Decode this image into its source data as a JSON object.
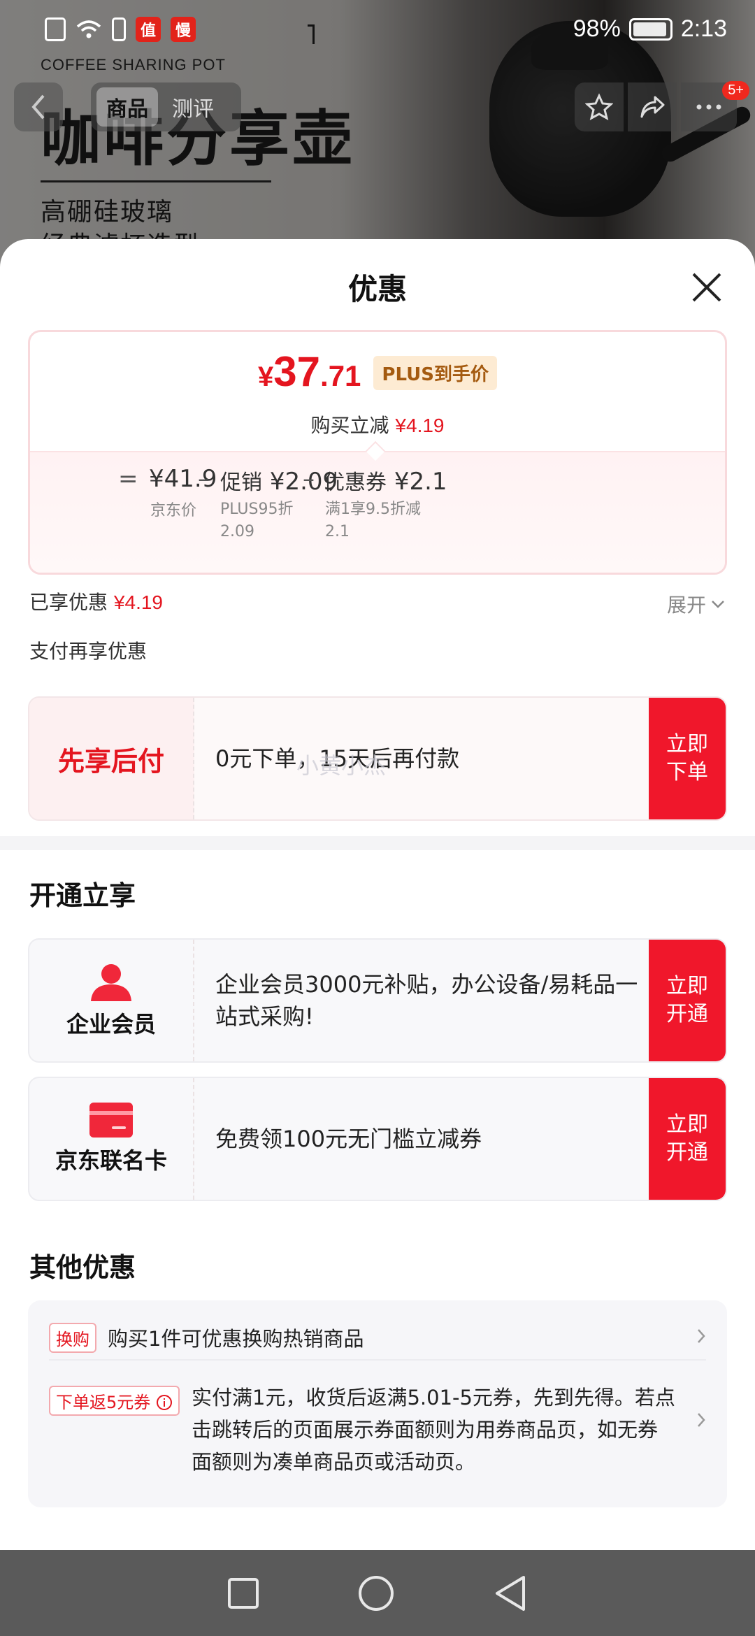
{
  "background": {
    "subtitle_en": "COFFEE SHARING POT",
    "title_cn": "咖啡分享壶",
    "line1": "高硼硅玻璃",
    "line2": "经典滤杯造型"
  },
  "status_bar": {
    "battery": "98%",
    "time": "2:13",
    "app_icon_1": "值",
    "app_icon_2": "慢"
  },
  "product_nav": {
    "tabs": [
      "商品",
      "测评"
    ],
    "badge": "5+"
  },
  "sheet": {
    "title": "优惠",
    "price_card": {
      "yen": "¥",
      "price_int": "37",
      "price_dec": ".71",
      "plus_badge": "PLUS到手价",
      "reduce_label": "购买立减",
      "reduce_value": "¥4.19",
      "eq": "=",
      "jd_price": "¥41.9",
      "jd_price_label": "京东价",
      "minus1": "–",
      "promo_label": "促销",
      "promo_value": "¥2.09",
      "promo_sub1": "PLUS95折",
      "promo_sub2": "2.09",
      "minus2": "–",
      "coupon_label": "优惠券",
      "coupon_value": "¥2.1",
      "coupon_sub1": "满1享9.5折减",
      "coupon_sub2": "2.1"
    },
    "enjoyed_label": "已享优惠",
    "enjoyed_value": "¥4.19",
    "expand_label": "展开",
    "pay_again_label": "支付再享优惠",
    "pay_later": {
      "title": "先享后付",
      "text": "0元下单，15天后再付款",
      "btn_line1": "立即",
      "btn_line2": "下单"
    },
    "watermark": "小黄小杰",
    "open_section_title": "开通立享",
    "enterprise": {
      "title": "企业会员",
      "text": " 企业会员3000元补贴，办公设备/易耗品一站式采购!",
      "btn_line1": "立即",
      "btn_line2": "开通"
    },
    "jd_card": {
      "title": "京东联名卡",
      "text": "免费领100元无门槛立减券",
      "btn_line1": "立即",
      "btn_line2": "开通"
    },
    "other_section_title": "其他优惠",
    "other": {
      "row1_tag": "换购",
      "row1_text": "购买1件可优惠换购热销商品",
      "row2_tag": "下单返5元券",
      "row2_text": "实付满1元，收货后返满5.01-5元券，先到先得。若点击跳转后的页面展示券面额则为用券商品页，如无券面额则为凑单商品页或活动页。"
    }
  },
  "colors": {
    "accent_red": "#e4151f",
    "button_red": "#f0172b",
    "plus_gold": "#a45a10"
  }
}
